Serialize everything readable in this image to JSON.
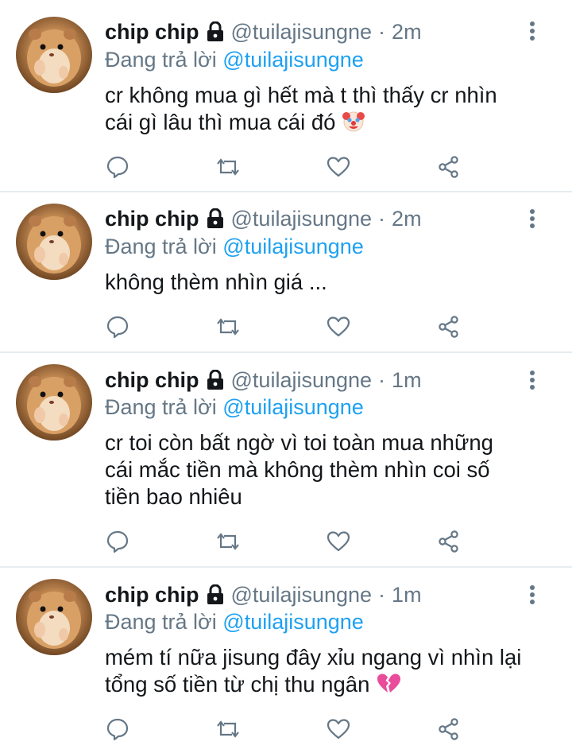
{
  "tweets": [
    {
      "name": "chip chip",
      "handle": "@tuilajisungne",
      "time": "2m",
      "reply_prefix": "Đang trả lời",
      "reply_to": "@tuilajisungne",
      "lines": [
        "cr không mua gì hết mà t thì thấy cr nhìn",
        "cái gì lâu thì mua cái đó"
      ],
      "trailing_emoji": "clown-face"
    },
    {
      "name": "chip chip",
      "handle": "@tuilajisungne",
      "time": "2m",
      "reply_prefix": "Đang trả lời",
      "reply_to": "@tuilajisungne",
      "lines": [
        "không thèm nhìn giá ..."
      ],
      "trailing_emoji": ""
    },
    {
      "name": "chip chip",
      "handle": "@tuilajisungne",
      "time": "1m",
      "reply_prefix": "Đang trả lời",
      "reply_to": "@tuilajisungne",
      "lines": [
        "cr toi còn bất ngờ vì toi toàn mua những",
        "cái mắc tiền mà không thèm nhìn coi số",
        "tiền bao nhiêu"
      ],
      "trailing_emoji": ""
    },
    {
      "name": "chip chip",
      "handle": "@tuilajisungne",
      "time": "1m",
      "reply_prefix": "Đang trả lời",
      "reply_to": "@tuilajisungne",
      "lines": [
        "mém tí nữa jisung đây xỉu ngang vì nhìn lại",
        "tổng số tiền từ chị thu ngân"
      ],
      "trailing_emoji": "broken-heart"
    }
  ],
  "separator": "·",
  "icons": {
    "protected": "lock-icon",
    "more": "more-vertical-icon",
    "reply": "reply-icon",
    "retweet": "retweet-icon",
    "like": "heart-icon",
    "share": "share-icon"
  },
  "colors": {
    "text": "#14171a",
    "muted": "#657786",
    "link": "#1da1f2",
    "divider": "#e6ecf0"
  }
}
